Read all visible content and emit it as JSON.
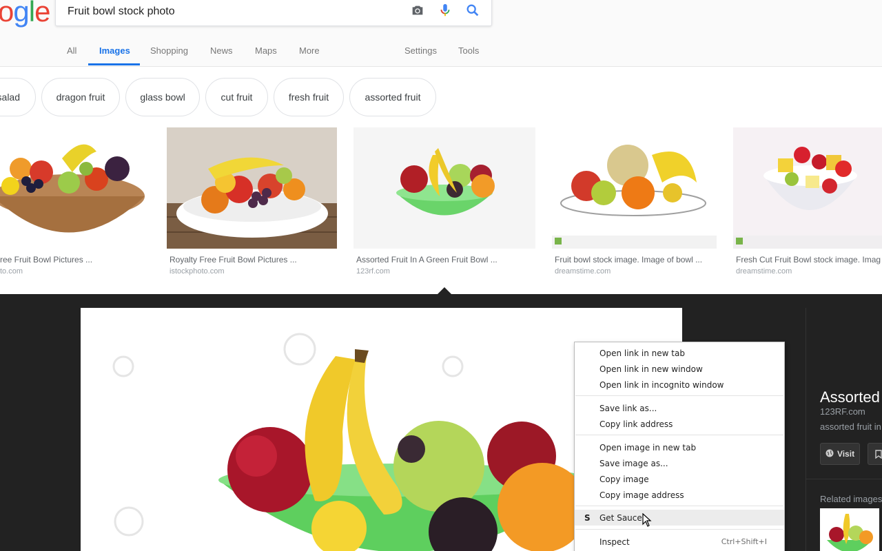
{
  "search": {
    "query": "Fruit bowl stock photo",
    "logo_text": [
      "o",
      "g",
      "l",
      "e"
    ],
    "logo_colors": [
      "#ea4335",
      "#4285f4",
      "#34a853",
      "#ea4335"
    ]
  },
  "tabs": [
    {
      "label": "All"
    },
    {
      "label": "Images",
      "active": true
    },
    {
      "label": "Shopping"
    },
    {
      "label": "News"
    },
    {
      "label": "Maps"
    },
    {
      "label": "More"
    },
    {
      "label": "Settings"
    },
    {
      "label": "Tools"
    }
  ],
  "chips": [
    {
      "label": "salad"
    },
    {
      "label": "dragon fruit"
    },
    {
      "label": "glass bowl"
    },
    {
      "label": "cut fruit"
    },
    {
      "label": "fresh fruit"
    },
    {
      "label": "assorted fruit"
    }
  ],
  "results": [
    {
      "title": "ree Fruit Bowl Pictures ...",
      "source": "to.com"
    },
    {
      "title": "Royalty Free Fruit Bowl Pictures ...",
      "source": "istockphoto.com"
    },
    {
      "title": "Assorted Fruit In A Green Fruit Bowl ...",
      "source": "123rf.com"
    },
    {
      "title": "Fruit bowl stock image. Image of bowl ...",
      "source": "dreamstime.com"
    },
    {
      "title": "Fresh Cut Fruit Bowl stock image. Imag",
      "source": "dreamstime.com"
    }
  ],
  "viewer": {
    "title": "Assorted",
    "domain": "123RF.com",
    "description": "assorted fruit in",
    "visit_label": "Visit",
    "related_label": "Related images"
  },
  "context_menu": {
    "groups": [
      [
        "Open link in new tab",
        "Open link in new window",
        "Open link in incognito window"
      ],
      [
        "Save link as...",
        "Copy link address"
      ],
      [
        "Open image in new tab",
        "Save image as...",
        "Copy image",
        "Copy image address"
      ],
      [
        "Get Sauce"
      ],
      [
        "Inspect"
      ]
    ],
    "get_sauce_icon": "S",
    "inspect_shortcut": "Ctrl+Shift+I",
    "hovered": "Get Sauce"
  },
  "colors": {
    "accent_blue": "#1a73e8",
    "viewer_bg": "#222222"
  }
}
